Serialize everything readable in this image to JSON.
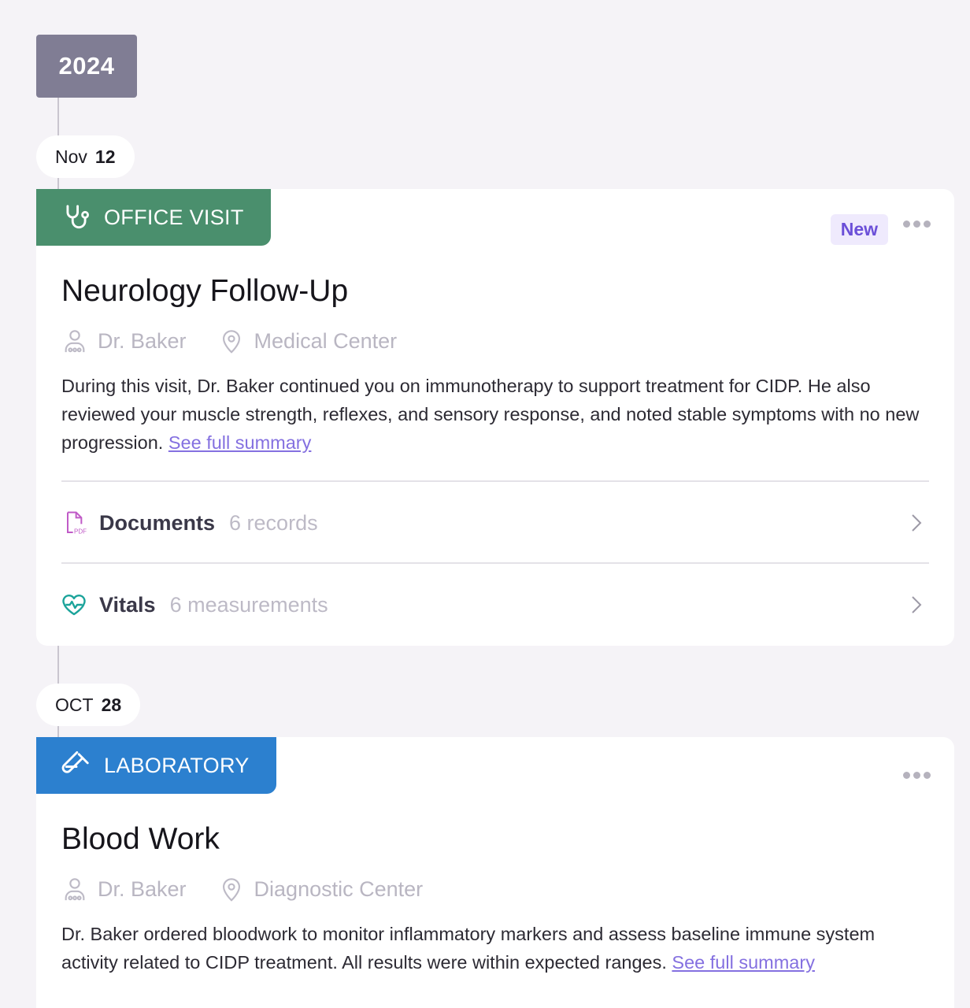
{
  "timeline": {
    "year": "2024",
    "entries": [
      {
        "date_month": "Nov",
        "date_day": "12",
        "category": "OFFICE VISIT",
        "category_icon": "stethoscope-icon",
        "category_color": "#4a8f6d",
        "badge": "New",
        "title": "Neurology Follow-Up",
        "doctor": "Dr. Baker",
        "location": "Medical Center",
        "summary": "During this visit, Dr. Baker continued you on immunotherapy to support treatment for CIDP. He also reviewed your muscle strength, reflexes, and sensory response, and noted stable symptoms with no new progression.",
        "summary_link": "See full summary",
        "documents": {
          "label": "Documents",
          "count": "6 records",
          "icon": "pdf-file-icon"
        },
        "vitals": {
          "label": "Vitals",
          "count": "6 measurements",
          "icon": "heart-pulse-icon"
        }
      },
      {
        "date_month": "OCT",
        "date_day": "28",
        "category": "LABORATORY",
        "category_icon": "test-tube-icon",
        "category_color": "#2c80cf",
        "title": "Blood Work",
        "doctor": "Dr. Baker",
        "location": "Diagnostic Center",
        "summary": "Dr. Baker ordered bloodwork to monitor inflammatory markers and assess baseline immune system activity related to CIDP treatment. All results were within expected ranges.",
        "summary_link": "See full summary"
      }
    ]
  }
}
